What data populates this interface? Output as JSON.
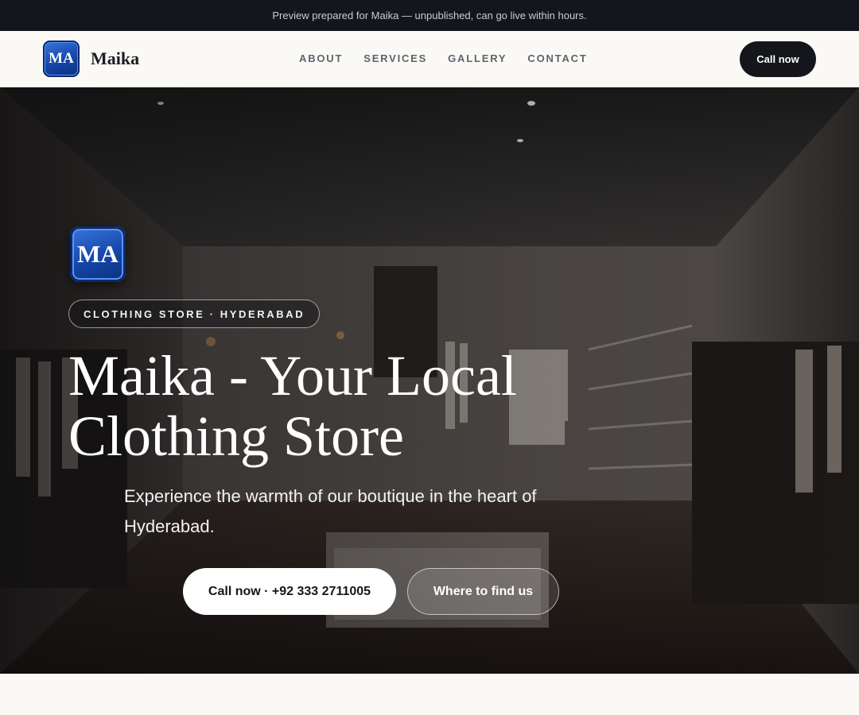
{
  "preview_bar": {
    "text": "Preview prepared for Maika — unpublished, can go live within hours."
  },
  "header": {
    "logo_initials": "MA",
    "brand_name": "Maika",
    "nav": [
      {
        "label": "ABOUT"
      },
      {
        "label": "SERVICES"
      },
      {
        "label": "GALLERY"
      },
      {
        "label": "CONTACT"
      }
    ],
    "cta_label": "Call now"
  },
  "hero": {
    "logo_initials": "MA",
    "tag": "CLOTHING STORE · HYDERABAD",
    "title": "Maika - Your Local Clothing Store",
    "subtitle": "Experience the warmth of our boutique in the heart of Hyderabad.",
    "primary_button": "Call now · +92 333 2711005",
    "secondary_button": "Where to find us",
    "background": "clothing-store-interior-photo"
  },
  "colors": {
    "dark": "#14161b",
    "logo_blue": "#1546a8",
    "page_bg": "#faf9f6"
  }
}
